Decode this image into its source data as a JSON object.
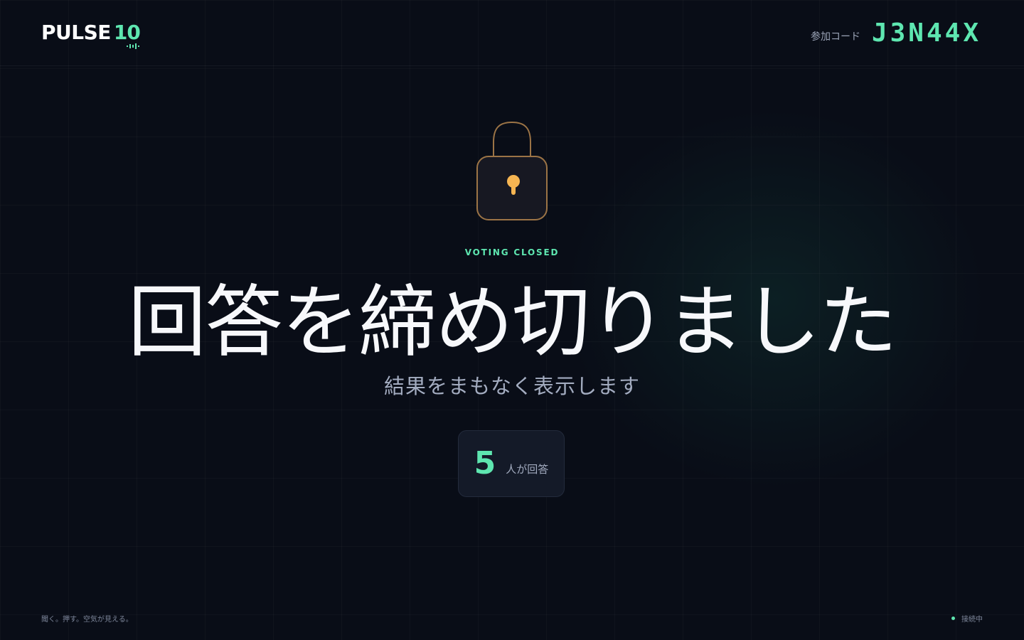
{
  "brand": {
    "name": "PULSE",
    "number": "10"
  },
  "header": {
    "join_label": "参加コード",
    "join_code": "J3N44X"
  },
  "status_screen": {
    "kicker": "VOTING CLOSED",
    "title": "回答を締め切りました",
    "subtitle": "結果をまもなく表示します",
    "lock_icon": "padlock-icon"
  },
  "respondents": {
    "count": "5",
    "unit": "人が回答"
  },
  "footer": {
    "tagline": "聞く。押す。空気が見える。",
    "connection": "接続中"
  },
  "colors": {
    "background": "#090d17",
    "accent": "#5ee6b0",
    "lock_keyhole": "#f6b552",
    "lock_outline": "#9c7446"
  }
}
